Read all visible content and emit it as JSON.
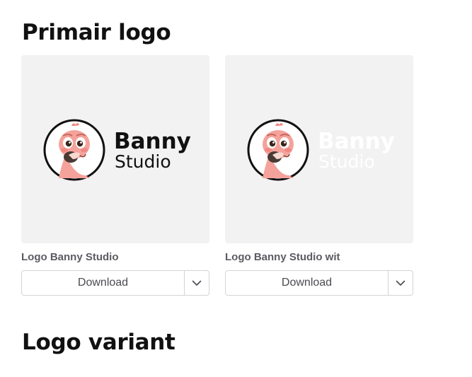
{
  "sections": {
    "primary_title": "Primair logo",
    "variant_title": "Logo variant"
  },
  "cards": [
    {
      "label": "Logo Banny Studio",
      "logo_word_1": "Banny",
      "logo_word_2": "Studio",
      "logo_text_color": "#111111",
      "download_label": "Download"
    },
    {
      "label": "Logo Banny Studio wit",
      "logo_word_1": "Banny",
      "logo_word_2": "Studio",
      "logo_text_color": "#ffffff",
      "download_label": "Download"
    }
  ],
  "icons": {
    "logo_mark": "flamingo-mascot-icon",
    "dropdown": "chevron-down-icon"
  },
  "colors": {
    "preview_background": "#f2f2f2",
    "button_border": "#d4d4d8",
    "label_text": "#5b5b63"
  }
}
